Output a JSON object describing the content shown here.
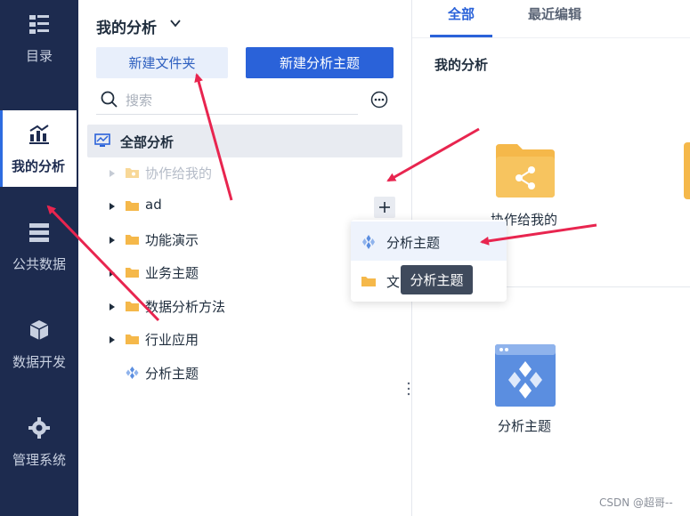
{
  "rail": {
    "items": [
      {
        "label": "目录",
        "icon": "catalog-icon"
      },
      {
        "label": "我的分析",
        "icon": "analysis-chart-icon",
        "active": true
      },
      {
        "label": "公共数据",
        "icon": "database-icon"
      },
      {
        "label": "数据开发",
        "icon": "cube-icon"
      },
      {
        "label": "管理系统",
        "icon": "gear-icon"
      }
    ]
  },
  "panel": {
    "title": "我的分析",
    "new_folder": "新建文件夹",
    "new_theme": "新建分析主题",
    "search_placeholder": "搜索",
    "root_label": "全部分析",
    "tree": [
      {
        "label": "协作给我的",
        "type": "shared-folder",
        "dim": true,
        "expandable": true
      },
      {
        "label": "ad",
        "type": "folder",
        "expandable": true
      },
      {
        "label": "功能演示",
        "type": "folder",
        "expandable": true
      },
      {
        "label": "业务主题",
        "type": "folder",
        "expandable": true
      },
      {
        "label": "数据分析方法",
        "type": "folder",
        "expandable": true
      },
      {
        "label": "行业应用",
        "type": "folder",
        "expandable": true
      },
      {
        "label": "分析主题",
        "type": "theme",
        "expandable": false
      }
    ]
  },
  "dropdown": {
    "items": [
      {
        "label": "分析主题",
        "icon": "theme-icon"
      },
      {
        "label": "文",
        "icon": "folder-icon"
      }
    ],
    "tooltip": "分析主题"
  },
  "content": {
    "tabs": [
      {
        "label": "全部",
        "active": true
      },
      {
        "label": "最近编辑"
      }
    ],
    "section_title": "我的分析",
    "cards": [
      {
        "label": "协作给我的",
        "icon": "shared-folder-icon"
      },
      {
        "label": "分析主题",
        "icon": "analysis-theme-icon"
      }
    ],
    "watermark": "CSDN @超哥--"
  },
  "colors": {
    "rail_bg": "#1d2b4f",
    "primary": "#2a62d9",
    "folder": "#f5b84a",
    "annotation": "#e8254f"
  }
}
